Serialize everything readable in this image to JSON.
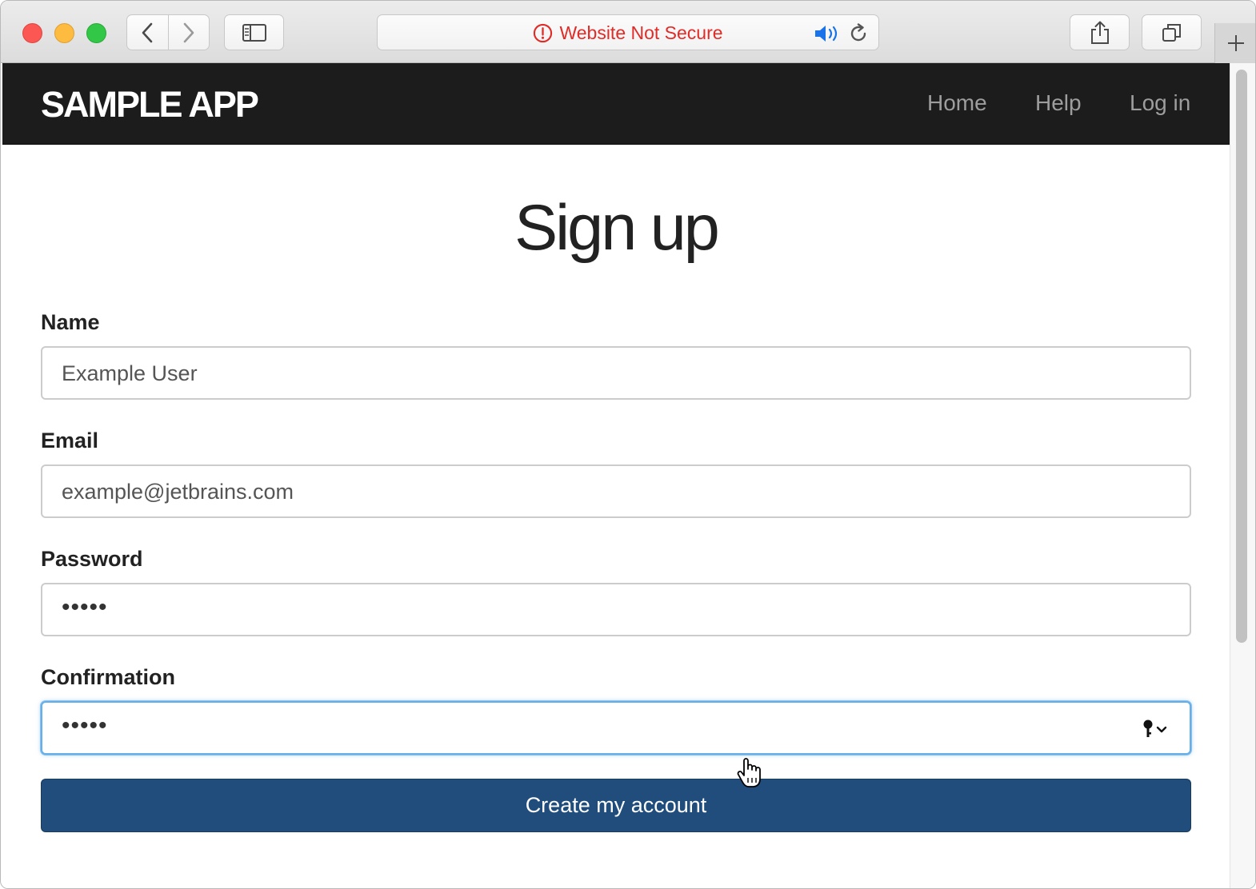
{
  "browser": {
    "url_warning": "Website Not Secure",
    "icons": {
      "back": "chevron-left-icon",
      "forward": "chevron-right-icon",
      "sidebar": "sidebar-icon",
      "warning": "exclamation-circle-icon",
      "audio": "speaker-icon",
      "reload": "reload-icon",
      "share": "share-icon",
      "tabs": "tabs-overview-icon",
      "new_tab": "plus-icon"
    },
    "colors": {
      "warning": "#e02b27",
      "traffic_red": "#fc5753",
      "traffic_yellow": "#fdbc40",
      "traffic_green": "#33c748"
    }
  },
  "navbar": {
    "brand": "SAMPLE APP",
    "links": [
      "Home",
      "Help",
      "Log in"
    ],
    "background": "#1c1c1c"
  },
  "form": {
    "title": "Sign up",
    "fields": [
      {
        "label": "Name",
        "value": "Example User"
      },
      {
        "label": "Email",
        "value": "example@jetbrains.com"
      },
      {
        "label": "Password",
        "value": "•••••"
      },
      {
        "label": "Confirmation",
        "value": "•••••"
      }
    ],
    "submit_label": "Create my account",
    "submit_color": "#204d7c",
    "password_manager_icon": "key-icon"
  }
}
